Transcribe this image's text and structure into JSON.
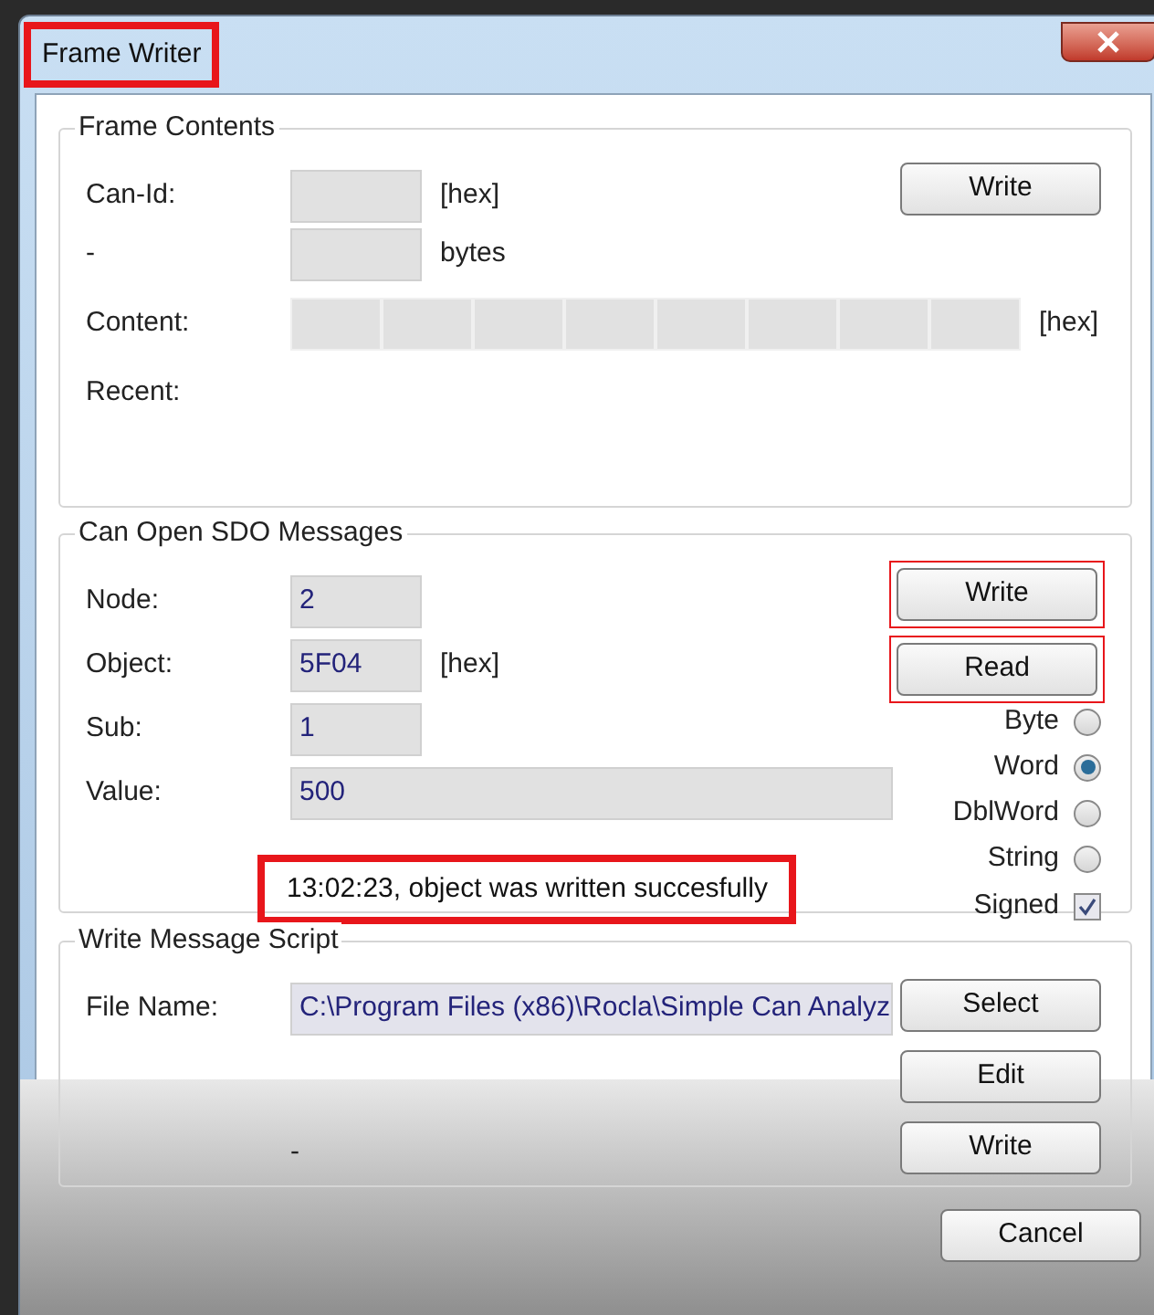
{
  "window": {
    "title": "Frame Writer",
    "title_highlighted": true
  },
  "frame_contents": {
    "title": "Frame Contents",
    "can_id_label": "Can-Id:",
    "can_id_unit": "[hex]",
    "length_label": "-",
    "length_unit": "bytes",
    "content_label": "Content:",
    "content_unit": "[hex]",
    "recent_label": "Recent:",
    "write_button": "Write"
  },
  "sdo": {
    "title": "Can Open SDO Messages",
    "fields": [
      {
        "label": "Node:",
        "value": "2",
        "kind": "short"
      },
      {
        "label": "Object:",
        "value": "5F04",
        "unit": "[hex]",
        "kind": "short"
      },
      {
        "label": "Sub:",
        "value": "1",
        "kind": "short"
      },
      {
        "label": "Value:",
        "value": "500",
        "kind": "long"
      }
    ],
    "buttons": [
      {
        "label": "Write",
        "highlighted": true
      },
      {
        "label": "Read",
        "highlighted": true
      }
    ],
    "types": [
      {
        "label": "Byte",
        "selected": false
      },
      {
        "label": "Word",
        "selected": true
      },
      {
        "label": "DblWord",
        "selected": false
      },
      {
        "label": "String",
        "selected": false
      }
    ],
    "signed": {
      "label": "Signed",
      "checked": true
    },
    "status": {
      "text": "13:02:23, object was written succesfully",
      "highlighted": true
    }
  },
  "script": {
    "title": "Write Message Script",
    "file_label": "File Name:",
    "file_value": "C:\\Program Files (x86)\\Rocla\\Simple Can Analyz",
    "status": "-",
    "buttons": [
      "Select",
      "Edit",
      "Write"
    ]
  },
  "cancel_button": "Cancel"
}
